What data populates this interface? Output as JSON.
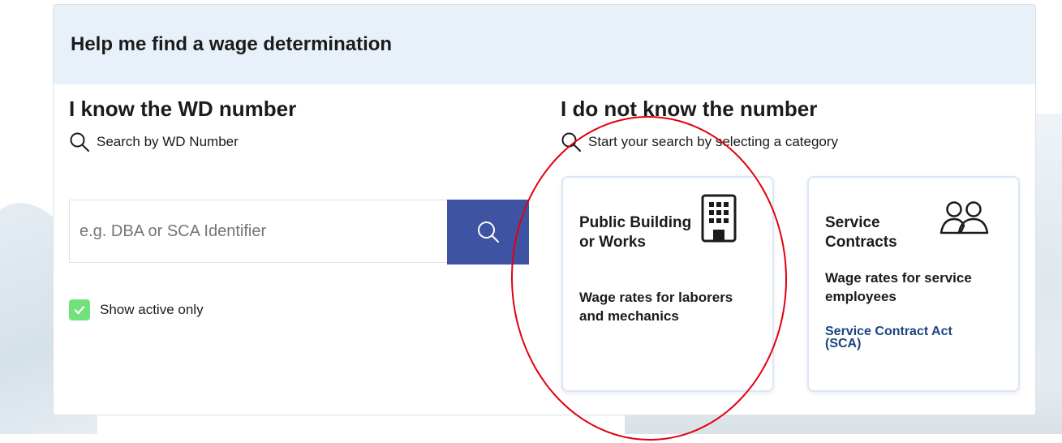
{
  "header": {
    "title": "Help me find a wage determination"
  },
  "known": {
    "heading": "I know the WD number",
    "subtext": "Search by WD Number",
    "search_placeholder": "e.g. DBA or SCA Identifier",
    "show_active_label": "Show active only",
    "show_active_checked": true
  },
  "unknown": {
    "heading": "I do not know the number",
    "subtext": "Start your search by selecting a category",
    "tiles": [
      {
        "title": "Public Building or Works",
        "description": "Wage rates for laborers and mechanics",
        "icon": "building-icon"
      },
      {
        "title": "Service Contracts",
        "description": "Wage rates for service employees",
        "link": "Service Contract Act (SCA)",
        "icon": "people-icon"
      }
    ]
  },
  "colors": {
    "header_bg": "#e8f1f9",
    "search_button": "#3e54a3",
    "checkbox": "#70e17b",
    "link": "#1a4480",
    "annotation": "#e3000f"
  }
}
